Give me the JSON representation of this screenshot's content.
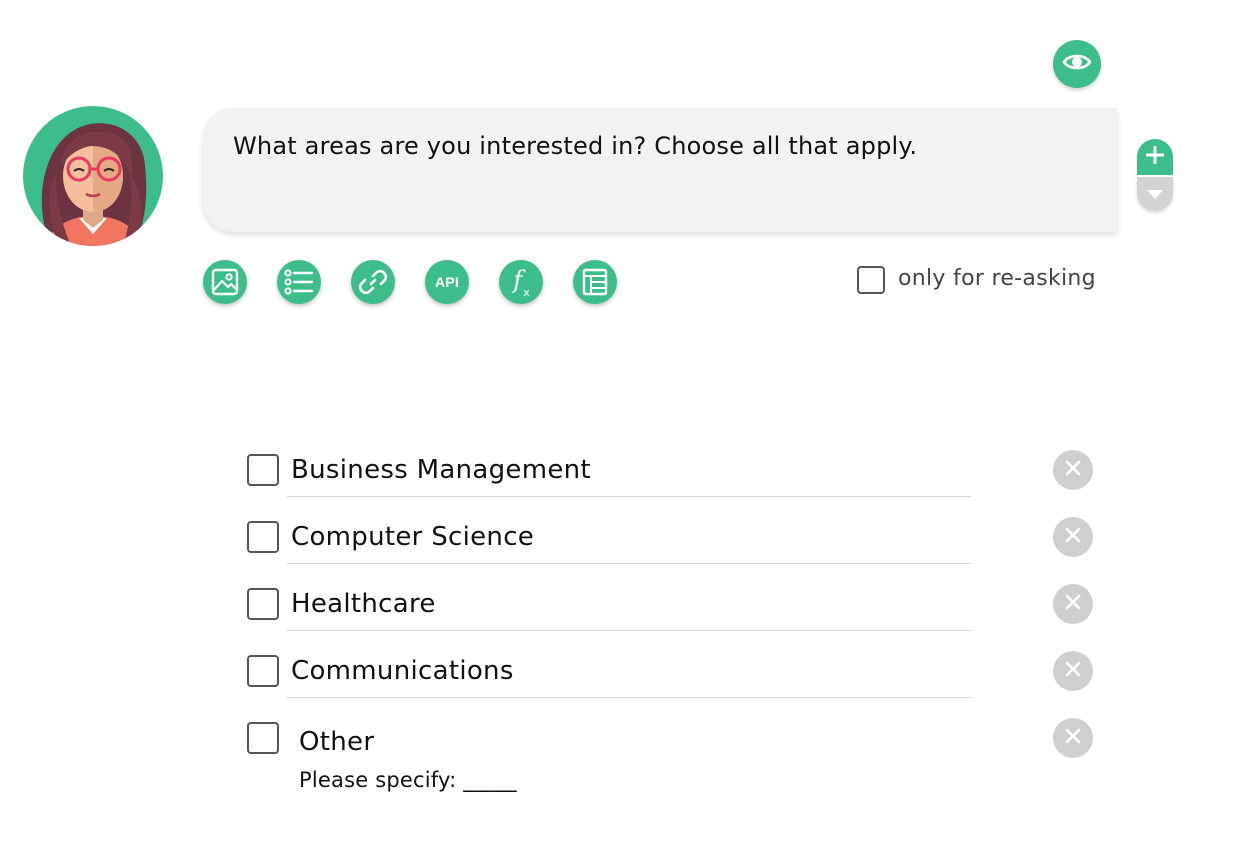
{
  "question": {
    "text": "What areas are you interested in? Choose all that apply."
  },
  "colors": {
    "accent": "#3dbd8c",
    "neutral_button": "#cfcfcf",
    "bubble": "#f2f2f2"
  },
  "toolbar": {
    "buttons": [
      {
        "icon": "image-icon"
      },
      {
        "icon": "list-icon"
      },
      {
        "icon": "link-icon"
      },
      {
        "icon": "api-icon",
        "label": "API"
      },
      {
        "icon": "function-icon",
        "label": "f",
        "sub": "x"
      },
      {
        "icon": "table-icon"
      }
    ]
  },
  "reask": {
    "label": "only for re-asking",
    "checked": false
  },
  "options": [
    {
      "label": "Business Management",
      "checked": false
    },
    {
      "label": "Computer Science",
      "checked": false
    },
    {
      "label": "Healthcare",
      "checked": false
    },
    {
      "label": "Communications",
      "checked": false
    },
    {
      "label": "Other",
      "checked": false,
      "sub": "Please specify: _____"
    }
  ]
}
